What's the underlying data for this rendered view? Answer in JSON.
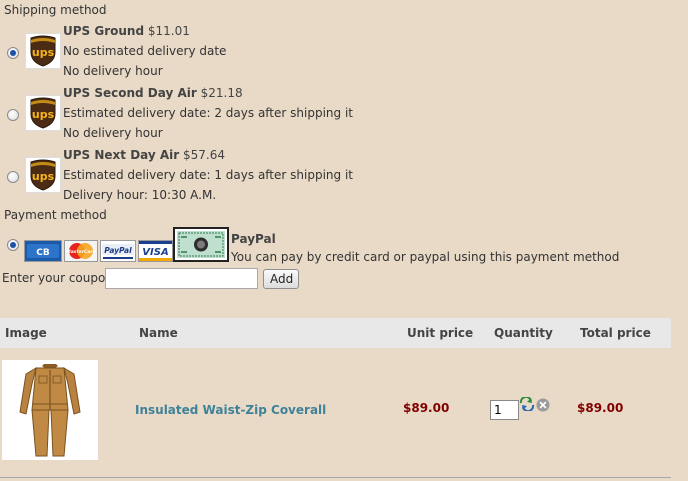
{
  "shipping": {
    "heading": "Shipping method",
    "options": [
      {
        "name": "UPS Ground",
        "price": "$11.01",
        "line1": "No estimated delivery date",
        "line2": "No delivery hour",
        "selected": true
      },
      {
        "name": "UPS Second Day Air",
        "price": "$21.18",
        "line1": "Estimated delivery date: 2 days after shipping it",
        "line2": "No delivery hour",
        "selected": false
      },
      {
        "name": "UPS Next Day Air",
        "price": "$57.64",
        "line1": "Estimated delivery date: 1 days after shipping it",
        "line2": "Delivery hour: 10:30 A.M.",
        "selected": false
      }
    ],
    "logo_text": "ups",
    "logo_color": "#4b2b14",
    "logo_accent": "#f7b617"
  },
  "payment": {
    "heading": "Payment method",
    "selected": true,
    "cards": [
      "CB",
      "MasterCard",
      "PayPal",
      "VISA"
    ],
    "method_name": "PayPal",
    "description": "You can pay by credit card or paypal using this payment method"
  },
  "coupon": {
    "label": "Enter your coupon",
    "value": "",
    "button_label": "Add"
  },
  "cart": {
    "headers": {
      "image": "Image",
      "name": "Name",
      "unit_price": "Unit price",
      "quantity": "Quantity",
      "total_price": "Total price"
    },
    "rows": [
      {
        "name": "Insulated Waist-Zip Coverall",
        "unit_price": "$89.00",
        "quantity": "1",
        "total_price": "$89.00"
      }
    ]
  },
  "colors": {
    "background": "#e9dac7",
    "header_bg": "#e8e8e8",
    "price": "#800000",
    "link": "#3e8299"
  }
}
